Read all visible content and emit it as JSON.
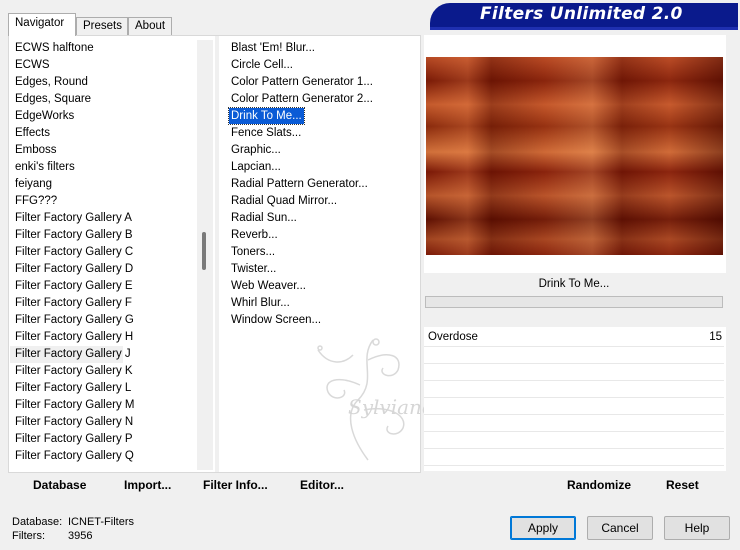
{
  "banner": {
    "title": "Filters Unlimited 2.0"
  },
  "tabs": [
    {
      "label": "Navigator",
      "active": true
    },
    {
      "label": "Presets",
      "active": false
    },
    {
      "label": "About",
      "active": false
    }
  ],
  "categories": {
    "selected": "Filter Factory Gallery J",
    "items": [
      "ECWS halftone",
      "ECWS",
      "Edges, Round",
      "Edges, Square",
      "EdgeWorks",
      "Effects",
      "Emboss",
      "enki's filters",
      "feiyang",
      "FFG???",
      "Filter Factory Gallery A",
      "Filter Factory Gallery B",
      "Filter Factory Gallery C",
      "Filter Factory Gallery D",
      "Filter Factory Gallery E",
      "Filter Factory Gallery F",
      "Filter Factory Gallery G",
      "Filter Factory Gallery H",
      "Filter Factory Gallery J",
      "Filter Factory Gallery K",
      "Filter Factory Gallery L",
      "Filter Factory Gallery M",
      "Filter Factory Gallery N",
      "Filter Factory Gallery P",
      "Filter Factory Gallery Q"
    ]
  },
  "filters": {
    "selected": "Drink To Me...",
    "items": [
      "Blast 'Em! Blur...",
      "Circle Cell...",
      "Color Pattern Generator 1...",
      "Color Pattern Generator 2...",
      "Drink To Me...",
      "Fence Slats...",
      "Graphic...",
      "Lapcian...",
      "Radial Pattern Generator...",
      "Radial Quad Mirror...",
      "Radial Sun...",
      "Reverb...",
      "Toners...",
      "Twister...",
      "Web Weaver...",
      "Whirl Blur...",
      "Window Screen..."
    ]
  },
  "left_buttons": {
    "database": "Database",
    "import": "Import...",
    "filter_info": "Filter Info...",
    "editor": "Editor..."
  },
  "preview": {
    "filter_name": "Drink To Me..."
  },
  "parameters": [
    {
      "label": "Overdose",
      "value": "15"
    }
  ],
  "right_buttons": {
    "randomize": "Randomize",
    "reset": "Reset"
  },
  "footer": {
    "database_label": "Database:",
    "database_value": "ICNET-Filters",
    "filters_label": "Filters:",
    "filters_value": "3956"
  },
  "dialog_buttons": {
    "apply": "Apply",
    "cancel": "Cancel",
    "help": "Help"
  },
  "watermark": {
    "text": "Sylviane"
  },
  "colors": {
    "banner": "#0a1a8c",
    "selection": "#0a5bd6",
    "default_button_border": "#0078d7"
  }
}
